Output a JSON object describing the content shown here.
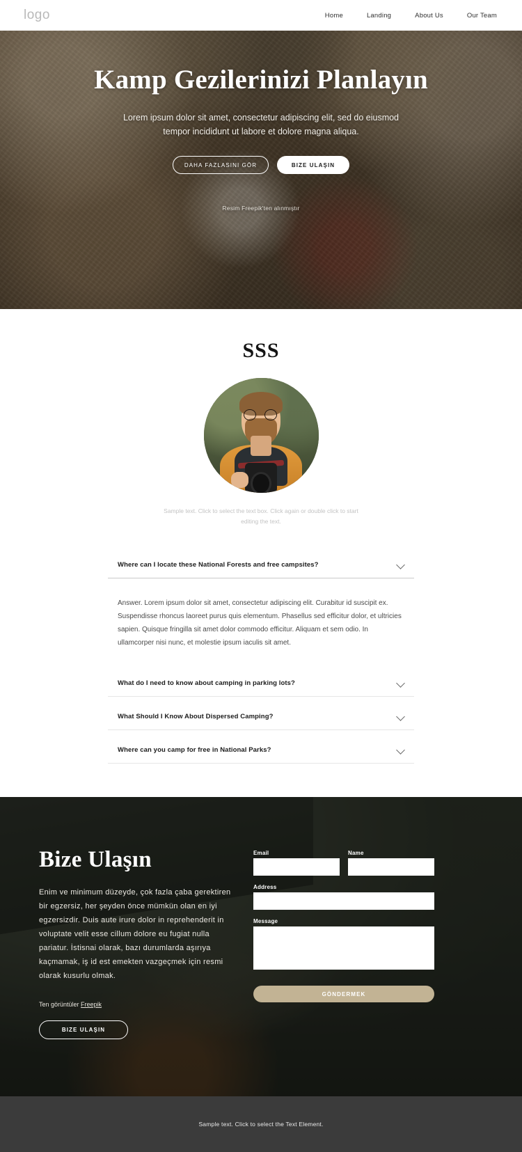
{
  "header": {
    "logo": "logo",
    "nav": [
      {
        "label": "Home"
      },
      {
        "label": "Landing"
      },
      {
        "label": "About Us"
      },
      {
        "label": "Our Team"
      }
    ]
  },
  "hero": {
    "title": "Kamp Gezilerinizi Planlayın",
    "subtitle": "Lorem ipsum dolor sit amet, consectetur adipiscing elit, sed do eiusmod tempor incididunt ut labore et dolore magna aliqua.",
    "primary_button": "DAHA FAZLASINI GÖR",
    "secondary_button": "BIZE ULAŞIN",
    "credit": "Resim Freepik'ten alınmıştır"
  },
  "faq": {
    "title": "SSS",
    "avatar_caption": "Sample text. Click to select the text box. Click again or double click to start editing the text.",
    "items": [
      {
        "question": "Where can I locate these National Forests and free campsites?",
        "answer": "Answer. Lorem ipsum dolor sit amet, consectetur adipiscing elit. Curabitur id suscipit ex. Suspendisse rhoncus laoreet purus quis elementum. Phasellus sed efficitur dolor, et ultricies sapien. Quisque fringilla sit amet dolor commodo efficitur. Aliquam et sem odio. In ullamcorper nisi nunc, et molestie ipsum iaculis sit amet.",
        "expanded": true
      },
      {
        "question": "What do I need to know about camping in parking lots?",
        "answer": "",
        "expanded": false
      },
      {
        "question": "What Should I Know About Dispersed Camping?",
        "answer": "",
        "expanded": false
      },
      {
        "question": "Where can you camp for free in National Parks?",
        "answer": "",
        "expanded": false
      }
    ]
  },
  "contact": {
    "title": "Bize Ulaşın",
    "text": "Enim ve minimum düzeyde, çok fazla çaba gerektiren bir egzersiz, her şeyden önce mümkün olan en iyi egzersizdir. Duis aute irure dolor in reprehenderit in voluptate velit esse cillum dolore eu fugiat nulla pariatur. İstisnai olarak, bazı durumlarda aşırıya kaçmamak, iş id est emekten vazgeçmek için resmi olarak kusurlu olmak.",
    "credit_prefix": "Ten görüntüler ",
    "credit_link": "Freepik",
    "button": "BIZE ULAŞIN",
    "form": {
      "email_label": "Email",
      "email_value": "",
      "name_label": "Name",
      "name_value": "",
      "address_label": "Address",
      "address_value": "",
      "message_label": "Message",
      "message_value": "",
      "submit_label": "GÖNDERMEK",
      "submit_color": "#c2b394"
    }
  },
  "footer": {
    "text": "Sample text. Click to select the Text Element."
  }
}
